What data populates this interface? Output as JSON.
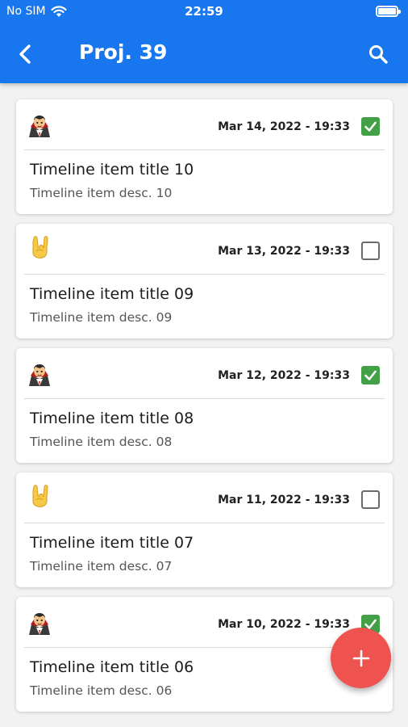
{
  "status_bar": {
    "carrier": "No SIM",
    "time": "22:59",
    "wifi_icon": "wifi-icon",
    "battery_icon": "battery-icon"
  },
  "app_bar": {
    "title": "Proj. 39",
    "back_icon": "chevron-left-icon",
    "search_icon": "search-icon",
    "color": "#1877ee"
  },
  "timeline": [
    {
      "icon": "vampire-emoji-icon",
      "date": "Mar 14, 2022 - 19:33",
      "done": true,
      "title": "Timeline item title 10",
      "desc": "Timeline item desc. 10"
    },
    {
      "icon": "rock-hand-emoji-icon",
      "date": "Mar 13, 2022 - 19:33",
      "done": false,
      "title": "Timeline item title 09",
      "desc": "Timeline item desc. 09"
    },
    {
      "icon": "vampire-emoji-icon",
      "date": "Mar 12, 2022 - 19:33",
      "done": true,
      "title": "Timeline item title 08",
      "desc": "Timeline item desc. 08"
    },
    {
      "icon": "rock-hand-emoji-icon",
      "date": "Mar 11, 2022 - 19:33",
      "done": false,
      "title": "Timeline item title 07",
      "desc": "Timeline item desc. 07"
    },
    {
      "icon": "vampire-emoji-icon",
      "date": "Mar 10, 2022 - 19:33",
      "done": true,
      "title": "Timeline item title 06",
      "desc": "Timeline item desc. 06"
    }
  ],
  "fab": {
    "icon": "plus-icon",
    "color": "#ef5350"
  },
  "colors": {
    "check_on": "#43a047"
  }
}
